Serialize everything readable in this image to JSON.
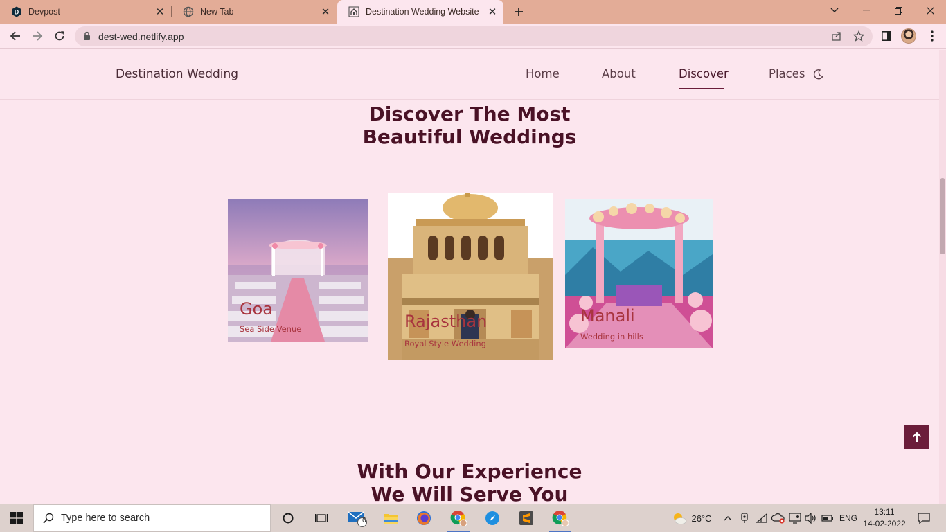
{
  "browser": {
    "tabs": [
      {
        "title": "Devpost",
        "icon": "devpost-logo-icon",
        "active": false
      },
      {
        "title": "New Tab",
        "icon": "globe-icon",
        "active": false
      },
      {
        "title": "Destination Wedding Website",
        "icon": "temple-favicon-icon",
        "active": true
      }
    ],
    "new_tab_icon": "plus-icon",
    "url": "dest-wed.netlify.app"
  },
  "site": {
    "logo": "Destination Wedding",
    "nav": [
      "Home",
      "About",
      "Discover",
      "Places"
    ],
    "active_nav": "Discover",
    "theme_toggle_icon": "moon-icon",
    "discover_title_line1": "Discover The Most",
    "discover_title_line2": "Beautiful Weddings",
    "cards": [
      {
        "name": "Goa",
        "subtitle": "Sea Side Venue"
      },
      {
        "name": "Rajasthan",
        "subtitle": "Royal Style Wedding"
      },
      {
        "name": "Manali",
        "subtitle": "Wedding in hills"
      }
    ],
    "experience_title_line1": "With Our Experience",
    "experience_title_line2": "We Will Serve You",
    "scroll_top_icon": "arrow-up-icon"
  },
  "taskbar": {
    "search_placeholder": "Type here to search",
    "mail_badge": "6",
    "weather": "26°C",
    "language": "ENG",
    "time": "13:11",
    "date": "14-02-2022"
  },
  "colors": {
    "page_bg": "#fce6ee",
    "accent": "#6b1d3a",
    "title": "#4a1226",
    "card_label": "#a8343e",
    "tab_strip": "#e3ac97"
  }
}
